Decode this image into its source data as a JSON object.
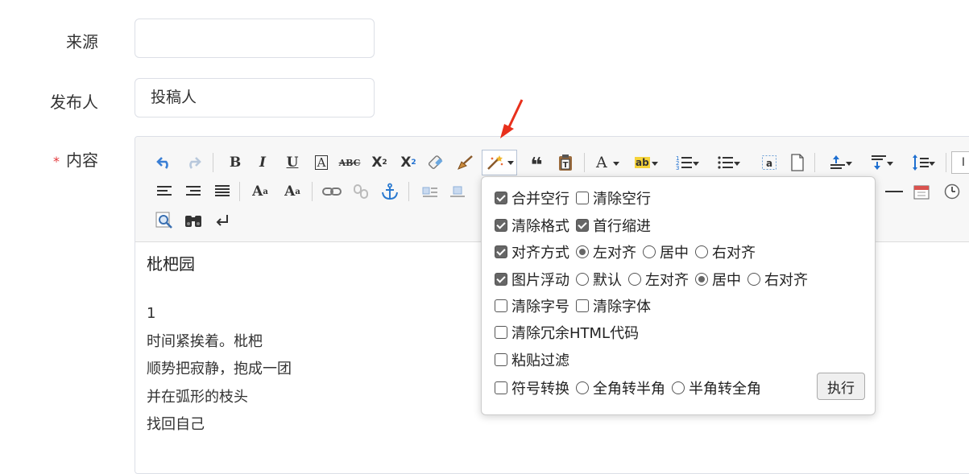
{
  "form": {
    "source_label": "来源",
    "source_value": "",
    "publisher_label": "发布人",
    "publisher_value": "投稿人",
    "content_required": "*",
    "content_label": "内容"
  },
  "toolbar": {
    "row1": [
      "undo-icon",
      "redo-icon",
      "bold-icon",
      "italic-icon",
      "underline-icon",
      "font-border-icon",
      "strikethrough-icon",
      "superscript-icon",
      "subscript-icon",
      "eraser-icon",
      "brush-icon",
      "autotypeset-icon",
      "blockquote-icon",
      "paste-text-icon",
      "font-color-icon",
      "highlight-icon",
      "ordered-list-icon",
      "unordered-list-icon",
      "select-all-icon",
      "cleardoc-icon",
      "row-spacing-top-icon",
      "row-spacing-bottom-icon",
      "line-height-icon"
    ],
    "row2": [
      "justify-left-icon",
      "justify-right-icon",
      "justify-full-icon",
      "ltr-icon",
      "rtl-icon",
      "link-icon",
      "unlink-icon",
      "anchor-icon",
      "image-left-icon",
      "image-center-icon",
      "horizontal-rule-icon",
      "date-icon",
      "time-icon"
    ],
    "row3": [
      "preview-icon",
      "search-replace-icon",
      "line-break-icon"
    ]
  },
  "editor": {
    "title": "枇杷园",
    "lines": [
      "1",
      "时间紧挨着。枇杷",
      "顺势把寂静，抱成一团",
      "并在弧形的枝头",
      "找回自己"
    ]
  },
  "autotypeset": {
    "merge_empty": "合并空行",
    "clear_empty": "清除空行",
    "clear_format": "清除格式",
    "indent": "首行缩进",
    "align": "对齐方式",
    "align_left": "左对齐",
    "align_center": "居中",
    "align_right": "右对齐",
    "image_float": "图片浮动",
    "img_default": "默认",
    "img_left": "左对齐",
    "img_center": "居中",
    "img_right": "右对齐",
    "clear_fontsize": "清除字号",
    "clear_fontfamily": "清除字体",
    "clear_redundant": "清除冗余HTML代码",
    "paste_filter": "粘贴过滤",
    "symbol_convert": "符号转换",
    "full_to_half": "全角转半角",
    "half_to_full": "半角转全角",
    "execute": "执行"
  },
  "colors": {
    "accent": "#1e6fd0",
    "arrow": "#e8301c",
    "required": "#e4393c"
  }
}
